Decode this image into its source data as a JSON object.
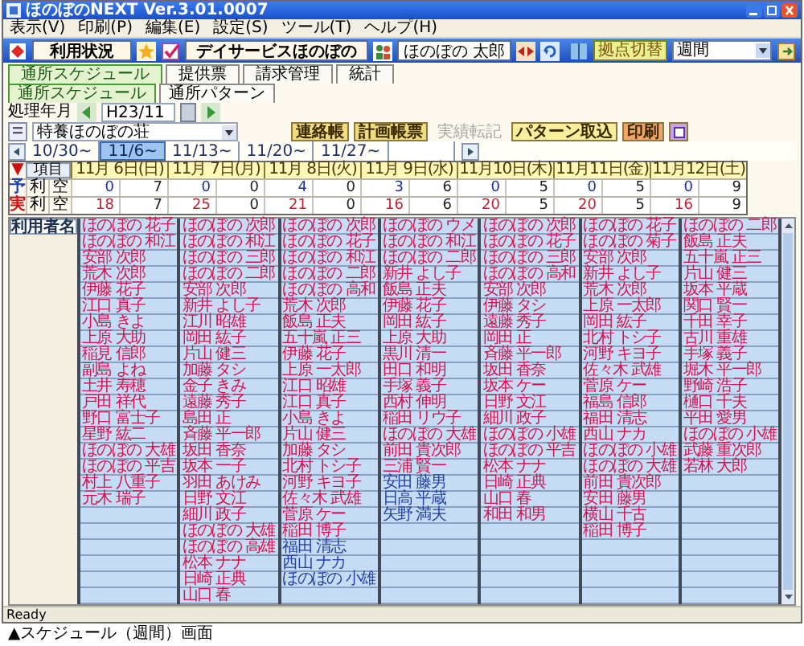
{
  "window": {
    "title": "ほのぼのNEXT Ver.3.01.0007"
  },
  "menu": [
    "表示(V)",
    "印刷(P)",
    "編集(E)",
    "設定(S)",
    "ツール(T)",
    "ヘルプ(H)"
  ],
  "toolbar": {
    "mode": "利用状況",
    "facility": "デイサービスほのぼの",
    "user": "ほのぼの 太郎",
    "site_label": "拠点切替",
    "site": "週間"
  },
  "tabs": [
    {
      "label": "通所スケジュール",
      "selected": true
    },
    {
      "label": "提供票",
      "selected": false
    },
    {
      "label": "請求管理",
      "selected": false
    },
    {
      "label": "統計",
      "selected": false
    }
  ],
  "subtabs": [
    {
      "label": "通所スケジュール",
      "selected": true
    },
    {
      "label": "通所パターン",
      "selected": false
    }
  ],
  "period": {
    "label": "処理年月",
    "value": "H23/11"
  },
  "office": {
    "value": "特養ほのぼの荘"
  },
  "actions": [
    {
      "kind": "text",
      "label": "連絡帳",
      "disabled": false,
      "color": "#f2dc7c"
    },
    {
      "kind": "text",
      "label": "計画帳票",
      "disabled": false,
      "color": "#f2dc7c"
    },
    {
      "kind": "text",
      "label": "実績転記",
      "disabled": true
    },
    {
      "kind": "text",
      "label": "パターン取込",
      "disabled": false,
      "color": "#f7ef9c"
    },
    {
      "kind": "text",
      "label": "印刷",
      "disabled": false,
      "color": "#f2a468"
    },
    {
      "kind": "icon",
      "disabled": false,
      "color": "#c8a2e6"
    }
  ],
  "weeks": [
    {
      "label": "10/30~",
      "selected": false
    },
    {
      "label": "11/6~",
      "selected": true
    },
    {
      "label": "11/13~",
      "selected": false
    },
    {
      "label": "11/20~",
      "selected": false
    },
    {
      "label": "11/27~",
      "selected": false
    }
  ],
  "summary": {
    "marker": "▼",
    "corner": "項目",
    "days": [
      "11月 6日(日)",
      "11月 7日(月)",
      "11月 8日(火)",
      "11月 9日(水)",
      "11月10日(木)",
      "11月11日(金)",
      "11月12日(土)"
    ],
    "rows": [
      {
        "mark": "予",
        "use_label": "利",
        "free_label": "空",
        "values": [
          "0",
          "7",
          "0",
          "0",
          "4",
          "0",
          "3",
          "6",
          "0",
          "5",
          "0",
          "5",
          "0",
          "9"
        ]
      },
      {
        "mark": "実",
        "use_label": "利",
        "free_label": "空",
        "values": [
          "18",
          "7",
          "25",
          "0",
          "21",
          "0",
          "16",
          "6",
          "20",
          "5",
          "20",
          "5",
          "16",
          "9"
        ]
      }
    ]
  },
  "roster": {
    "heading": "利用者名",
    "columns": [
      [
        {
          "name": "ほのぼの 花子",
          "color": "#d3124f"
        },
        {
          "name": "ほのぼの 和江",
          "color": "#d3124f"
        },
        {
          "name": "安部 次郎",
          "color": "#d3124f"
        },
        {
          "name": "荒木 次郎",
          "color": "#d3124f"
        },
        {
          "name": "伊藤 花子",
          "color": "#d3124f"
        },
        {
          "name": "江口 真子",
          "color": "#d3124f"
        },
        {
          "name": "小島 きよ",
          "color": "#d3124f"
        },
        {
          "name": "上原 大助",
          "color": "#d3124f"
        },
        {
          "name": "稲見 信郎",
          "color": "#d3124f"
        },
        {
          "name": "副島 よね",
          "color": "#d3124f"
        },
        {
          "name": "土井 寿穂",
          "color": "#d3124f"
        },
        {
          "name": "戸田 祥代",
          "color": "#d3124f"
        },
        {
          "name": "野口 富士子",
          "color": "#d3124f"
        },
        {
          "name": "星野 紘二",
          "color": "#d3124f"
        },
        {
          "name": "ほのぼの 大雄",
          "color": "#d3124f"
        },
        {
          "name": "ほのぼの 平吉",
          "color": "#d3124f"
        },
        {
          "name": "村上 八重子",
          "color": "#d3124f"
        },
        {
          "name": "元木 瑞子",
          "color": "#d3124f"
        }
      ],
      [
        {
          "name": "ほのぼの 次郎",
          "color": "#d3124f"
        },
        {
          "name": "ほのぼの 和江",
          "color": "#d3124f"
        },
        {
          "name": "ほのぼの 三郎",
          "color": "#d3124f"
        },
        {
          "name": "ほのぼの 二郎",
          "color": "#d3124f"
        },
        {
          "name": "安部 次郎",
          "color": "#d3124f"
        },
        {
          "name": "新井 よし子",
          "color": "#d3124f"
        },
        {
          "name": "江川 昭雄",
          "color": "#d3124f"
        },
        {
          "name": "岡田 紘子",
          "color": "#d3124f"
        },
        {
          "name": "片山 健三",
          "color": "#d3124f"
        },
        {
          "name": "加藤 タシ",
          "color": "#d3124f"
        },
        {
          "name": "金子 きみ",
          "color": "#d3124f"
        },
        {
          "name": "遠藤 秀子",
          "color": "#d3124f"
        },
        {
          "name": "島田 正",
          "color": "#d3124f"
        },
        {
          "name": "斉藤 平一郎",
          "color": "#d3124f"
        },
        {
          "name": "坂田 香奈",
          "color": "#d3124f"
        },
        {
          "name": "坂本 一子",
          "color": "#d3124f"
        },
        {
          "name": "羽田 あけみ",
          "color": "#d3124f"
        },
        {
          "name": "日野 文江",
          "color": "#d3124f"
        },
        {
          "name": "細川 政子",
          "color": "#d3124f"
        },
        {
          "name": "ほのぼの 大雄",
          "color": "#d3124f"
        },
        {
          "name": "ほのぼの 高雄",
          "color": "#d3124f"
        },
        {
          "name": "松本 ナナ",
          "color": "#d3124f"
        },
        {
          "name": "日崎 正典",
          "color": "#d3124f"
        },
        {
          "name": "山口 春",
          "color": "#d3124f"
        }
      ],
      [
        {
          "name": "ほのぼの 次郎",
          "color": "#d3124f"
        },
        {
          "name": "ほのぼの 花子",
          "color": "#d3124f"
        },
        {
          "name": "ほのぼの 和江",
          "color": "#d3124f"
        },
        {
          "name": "ほのぼの 二郎",
          "color": "#d3124f"
        },
        {
          "name": "ほのぼの 高和",
          "color": "#d3124f"
        },
        {
          "name": "荒木 次郎",
          "color": "#d3124f"
        },
        {
          "name": "飯島 正夫",
          "color": "#d3124f"
        },
        {
          "name": "五十嵐 正三",
          "color": "#d3124f"
        },
        {
          "name": "伊藤 花子",
          "color": "#d3124f"
        },
        {
          "name": "上原 一太郎",
          "color": "#d3124f"
        },
        {
          "name": "江口 昭雄",
          "color": "#d3124f"
        },
        {
          "name": "江口 真子",
          "color": "#d3124f"
        },
        {
          "name": "小島 きよ",
          "color": "#d3124f"
        },
        {
          "name": "片山 健三",
          "color": "#d3124f"
        },
        {
          "name": "加藤 タシ",
          "color": "#d3124f"
        },
        {
          "name": "北村 トシ子",
          "color": "#d3124f"
        },
        {
          "name": "河野 キヨ子",
          "color": "#d3124f"
        },
        {
          "name": "佐々木 武雄",
          "color": "#d3124f"
        },
        {
          "name": "菅原 ケー",
          "color": "#d3124f"
        },
        {
          "name": "稲田 博子",
          "color": "#d3124f"
        },
        {
          "name": "福田 清志",
          "color": "#2340a6"
        },
        {
          "name": "西山 ナカ",
          "color": "#2340a6"
        },
        {
          "name": "ほのぼの 小雄",
          "color": "#2340a6"
        }
      ],
      [
        {
          "name": "ほのぼの ウメ",
          "color": "#d3124f"
        },
        {
          "name": "ほのぼの 和江",
          "color": "#d3124f"
        },
        {
          "name": "ほのぼの 二郎",
          "color": "#d3124f"
        },
        {
          "name": "新井 よし子",
          "color": "#d3124f"
        },
        {
          "name": "飯島 正夫",
          "color": "#d3124f"
        },
        {
          "name": "伊藤 花子",
          "color": "#d3124f"
        },
        {
          "name": "岡田 紘子",
          "color": "#d3124f"
        },
        {
          "name": "上原 大助",
          "color": "#d3124f"
        },
        {
          "name": "黒川 清一",
          "color": "#d3124f"
        },
        {
          "name": "田口 和明",
          "color": "#d3124f"
        },
        {
          "name": "手塚 義子",
          "color": "#d3124f"
        },
        {
          "name": "西村 伸明",
          "color": "#d3124f"
        },
        {
          "name": "稲田 リウ子",
          "color": "#d3124f"
        },
        {
          "name": "ほのぼの 大雄",
          "color": "#d3124f"
        },
        {
          "name": "前田 貴次郎",
          "color": "#d3124f"
        },
        {
          "name": "三浦 賢一",
          "color": "#d3124f"
        },
        {
          "name": "安田 藤男",
          "color": "#2340a6"
        },
        {
          "name": "日高 平蔵",
          "color": "#2340a6"
        },
        {
          "name": "矢野 満夫",
          "color": "#2340a6"
        }
      ],
      [
        {
          "name": "ほのぼの 次郎",
          "color": "#d3124f"
        },
        {
          "name": "ほのぼの 花子",
          "color": "#d3124f"
        },
        {
          "name": "ほのぼの 三郎",
          "color": "#d3124f"
        },
        {
          "name": "ほのぼの 高和",
          "color": "#d3124f"
        },
        {
          "name": "安部 次郎",
          "color": "#d3124f"
        },
        {
          "name": "伊藤 タシ",
          "color": "#d3124f"
        },
        {
          "name": "遠藤 秀子",
          "color": "#d3124f"
        },
        {
          "name": "岡田 正",
          "color": "#d3124f"
        },
        {
          "name": "斉藤 平一郎",
          "color": "#d3124f"
        },
        {
          "name": "坂田 香奈",
          "color": "#d3124f"
        },
        {
          "name": "坂本 ケー",
          "color": "#d3124f"
        },
        {
          "name": "日野 文江",
          "color": "#d3124f"
        },
        {
          "name": "細川 政子",
          "color": "#d3124f"
        },
        {
          "name": "ほのぼの 小雄",
          "color": "#d3124f"
        },
        {
          "name": "ほのぼの 平吉",
          "color": "#d3124f"
        },
        {
          "name": "松本 ナナ",
          "color": "#d3124f"
        },
        {
          "name": "日崎 正典",
          "color": "#d3124f"
        },
        {
          "name": "山口 春",
          "color": "#d3124f"
        },
        {
          "name": "和田 和男",
          "color": "#d3124f"
        }
      ],
      [
        {
          "name": "ほのぼの 花子",
          "color": "#d3124f"
        },
        {
          "name": "ほのぼの 菊子",
          "color": "#d3124f"
        },
        {
          "name": "安部 次郎",
          "color": "#d3124f"
        },
        {
          "name": "新井 よし子",
          "color": "#d3124f"
        },
        {
          "name": "荒木 次郎",
          "color": "#d3124f"
        },
        {
          "name": "上原 一太郎",
          "color": "#d3124f"
        },
        {
          "name": "岡田 紘子",
          "color": "#d3124f"
        },
        {
          "name": "北村 トシ子",
          "color": "#d3124f"
        },
        {
          "name": "河野 キヨ子",
          "color": "#d3124f"
        },
        {
          "name": "佐々木 武雄",
          "color": "#d3124f"
        },
        {
          "name": "菅原 ケー",
          "color": "#d3124f"
        },
        {
          "name": "福島 信郎",
          "color": "#d3124f"
        },
        {
          "name": "福田 清志",
          "color": "#d3124f"
        },
        {
          "name": "西山 ナカ",
          "color": "#d3124f"
        },
        {
          "name": "ほのぼの 小雄",
          "color": "#d3124f"
        },
        {
          "name": "ほのぼの 大雄",
          "color": "#d3124f"
        },
        {
          "name": "前田 貴次郎",
          "color": "#d3124f"
        },
        {
          "name": "安田 藤男",
          "color": "#d3124f"
        },
        {
          "name": "横山 千古",
          "color": "#d3124f"
        },
        {
          "name": "稲田 博子",
          "color": "#d3124f"
        }
      ],
      [
        {
          "name": "ほのぼの 二郎",
          "color": "#d3124f"
        },
        {
          "name": "飯島 正夫",
          "color": "#d3124f"
        },
        {
          "name": "五十嵐 正三",
          "color": "#d3124f"
        },
        {
          "name": "片山 健三",
          "color": "#d3124f"
        },
        {
          "name": "坂本 平蔵",
          "color": "#d3124f"
        },
        {
          "name": "関口 賢一",
          "color": "#d3124f"
        },
        {
          "name": "千田 幸子",
          "color": "#d3124f"
        },
        {
          "name": "古川 重雄",
          "color": "#d3124f"
        },
        {
          "name": "手塚 義子",
          "color": "#d3124f"
        },
        {
          "name": "堀木 平一郎",
          "color": "#d3124f"
        },
        {
          "name": "野崎 浩子",
          "color": "#d3124f"
        },
        {
          "name": "樋口 千夫",
          "color": "#d3124f"
        },
        {
          "name": "平田 愛男",
          "color": "#d3124f"
        },
        {
          "name": "ほのぼの 小雄",
          "color": "#d3124f"
        },
        {
          "name": "武藤 重次郎",
          "color": "#d3124f"
        },
        {
          "name": "若林 大郎",
          "color": "#d3124f"
        }
      ]
    ]
  },
  "status_bar": "Ready",
  "caption": "▲スケジュール（週間）画面"
}
